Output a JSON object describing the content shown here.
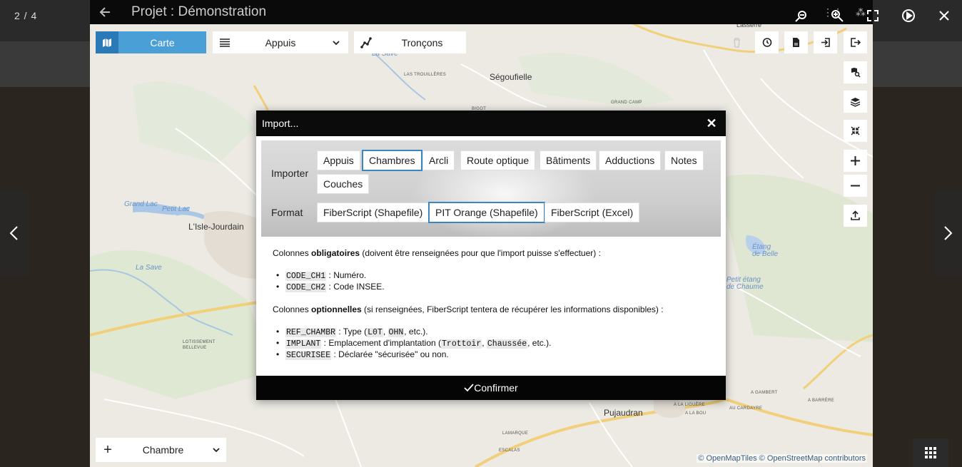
{
  "lightbox": {
    "counter": "2 / 4",
    "tools": [
      "zoom-out-icon",
      "zoom-in-icon",
      "fullscreen-icon",
      "play-icon",
      "close-icon"
    ],
    "thumbnails_icon": "grid-icon"
  },
  "app": {
    "title": "Projet : Démonstration",
    "toolbar": {
      "carte": "Carte",
      "appuis": "Appuis",
      "troncons": "Tronçons"
    },
    "bottom_select": "Chambre",
    "attribution": "© OpenMapTiles © OpenStreetMap contributors"
  },
  "map_places": {
    "lisle": "L'Isle-Jourdain",
    "segoufielle": "Ségoufielle",
    "pujaudran": "Pujaudran",
    "grand_camp": "GRAND CAMP",
    "bigot": "BIGOT",
    "trouilleres": "LAS TROUILLÈRES",
    "lotissement": "LOTISSEMENT BELLEVUE",
    "gambert": "A GAMBERT",
    "barrere": "A BARRÈRE",
    "liguere": "A LA LIGUÈRE",
    "bou": "A LA BOU",
    "cardayre": "AU CARDAYRE",
    "lamarque": "LAMARQUE",
    "escalas": "ESCALAS",
    "lasserre": "Lasserre",
    "la_save_top": "La Save",
    "la_save_mid": "La Save",
    "grand_lac": "Grand Lac",
    "petit_lac": "Petit Lac",
    "etang_belle": "Étang de Belle",
    "petit_etang": "Petit étang de Chaume"
  },
  "modal": {
    "title": "Import...",
    "importer_label": "Importer",
    "format_label": "Format",
    "importer_options": [
      "Appuis",
      "Chambres",
      "Arcli",
      "Route optique",
      "Bâtiments",
      "Adductions",
      "Notes",
      "Couches"
    ],
    "importer_selected": "Chambres",
    "format_options": [
      "FiberScript (Shapefile)",
      "PIT Orange (Shapefile)",
      "FiberScript (Excel)"
    ],
    "format_selected": "PIT Orange (Shapefile)",
    "required_prefix": "Colonnes ",
    "required_bold": "obligatoires",
    "required_suffix": " (doivent être renseignées pour que l'import puisse s'effectuer) :",
    "required_items": [
      {
        "code": "CODE_CH1",
        "desc": " : Numéro."
      },
      {
        "code": "CODE_CH2",
        "desc": " : Code INSEE."
      }
    ],
    "optional_prefix": "Colonnes ",
    "optional_bold": "optionnelles",
    "optional_suffix": " (si renseignées, FiberScript tentera de récupérer les informations disponibles) :",
    "optional_items": {
      "ref": {
        "code": "REF_CHAMBR",
        "t1": " : Type (",
        "c1": "L0T",
        "t2": ", ",
        "c2": "OHN",
        "t3": ", etc.)."
      },
      "implant": {
        "code": "IMPLANT",
        "t1": " : Emplacement d'implantation (",
        "c1": "Trottoir",
        "t2": ", ",
        "c2": "Chaussée",
        "t3": ", etc.)."
      },
      "securisee": {
        "code": "SECURISEE",
        "t1": " : Déclarée \"sécurisée\" ou non."
      }
    },
    "confirm": "Confirmer"
  },
  "colors": {
    "accent": "#4aa0d6",
    "accent_dark": "#2a7ab8",
    "selected_border": "#3a86c0"
  }
}
